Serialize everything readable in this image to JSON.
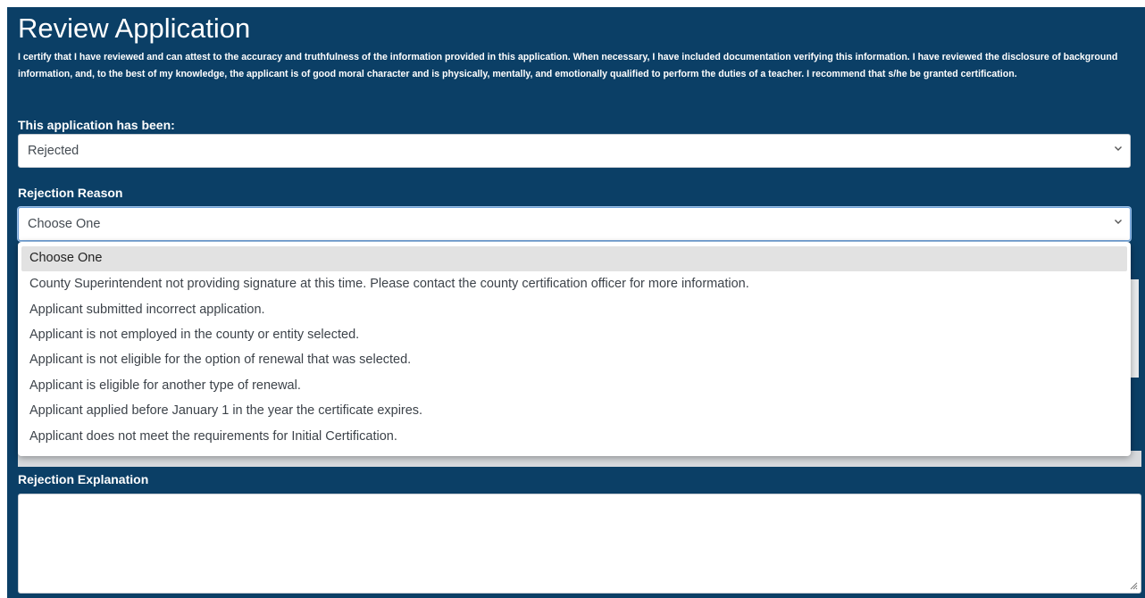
{
  "page": {
    "title": "Review Application",
    "certify_text": "I certify that I have reviewed and can attest to the accuracy and truthfulness of the information provided in this application. When necessary, I have included documentation verifying this information. I have reviewed the disclosure of background information, and, to the best of my knowledge, the applicant is of good moral character and is physically, mentally, and emotionally qualified to perform the duties of a teacher. I recommend that s/he be granted certification."
  },
  "status": {
    "label": "This application has been:",
    "value": "Rejected"
  },
  "rejection_reason": {
    "label": "Rejection Reason",
    "value": "Choose One",
    "options": [
      "Choose One",
      "County Superintendent not providing signature at this time. Please contact the county certification officer for more information.",
      "Applicant submitted incorrect application.",
      "Applicant is not employed in the county or entity selected.",
      "Applicant is not eligible for the option of renewal that was selected.",
      "Applicant is eligible for another type of renewal.",
      "Applicant applied before January 1 in the year the certificate expires.",
      "Applicant does not meet the requirements for Initial Certification."
    ]
  },
  "rejection_explanation": {
    "label": "Rejection Explanation",
    "value": ""
  },
  "icons": {
    "chevron": "chevron-down-icon",
    "resize": "resize-grip-icon"
  },
  "colors": {
    "panel_bg": "#0b3f66",
    "selected_option_bg": "#e2e2e2",
    "focus_border": "#6d9fd6"
  }
}
